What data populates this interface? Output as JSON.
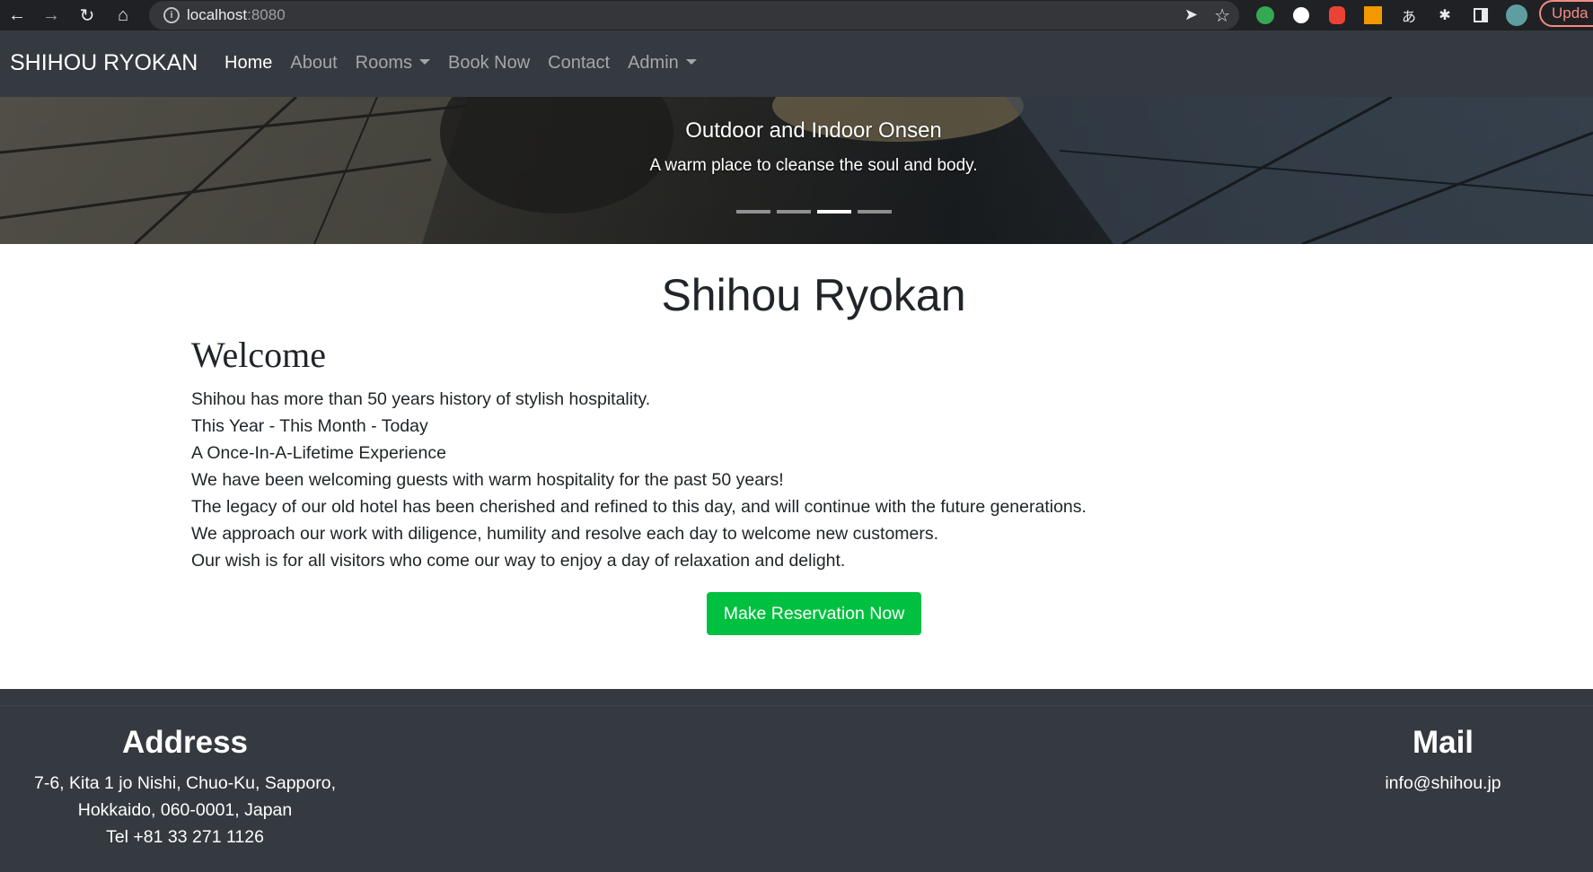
{
  "browser": {
    "url_host": "localhost",
    "url_port": ":8080",
    "update_label": "Upda"
  },
  "navbar": {
    "brand": "SHIHOU RYOKAN",
    "links": [
      {
        "label": "Home"
      },
      {
        "label": "About"
      },
      {
        "label": "Rooms"
      },
      {
        "label": "Book Now"
      },
      {
        "label": "Contact"
      },
      {
        "label": "Admin"
      }
    ]
  },
  "carousel": {
    "caption_title": "Outdoor and Indoor Onsen",
    "caption_text": "A warm place to cleanse the soul and body.",
    "slide_count": 4,
    "active_slide": 3
  },
  "main": {
    "title": "Shihou Ryokan",
    "welcome_heading": "Welcome",
    "paragraphs": [
      "Shihou has more than 50 years history of stylish hospitality.",
      "This Year - This Month - Today",
      "A Once-In-A-Lifetime Experience",
      "We have been welcoming guests with warm hospitality for the past 50 years!",
      "The legacy of our old hotel has been cherished and refined to this day, and will continue with the future generations.",
      "We approach our work with diligence, humility and resolve each day to welcome new customers.",
      "Our wish is for all visitors who come our way to enjoy a day of relaxation and delight."
    ],
    "reserve_button": "Make Reservation Now"
  },
  "footer": {
    "address_heading": "Address",
    "address_lines": [
      "7-6, Kita 1 jo Nishi, Chuo-Ku, Sapporo,",
      "Hokkaido, 060-0001, Japan",
      "Tel +81 33 271 1126"
    ],
    "mail_heading": "Mail",
    "mail": "info@shihou.jp"
  },
  "colors": {
    "navbar_bg": "#343a40",
    "reserve_button_bg": "#00c040",
    "chrome_bg": "#202124"
  }
}
